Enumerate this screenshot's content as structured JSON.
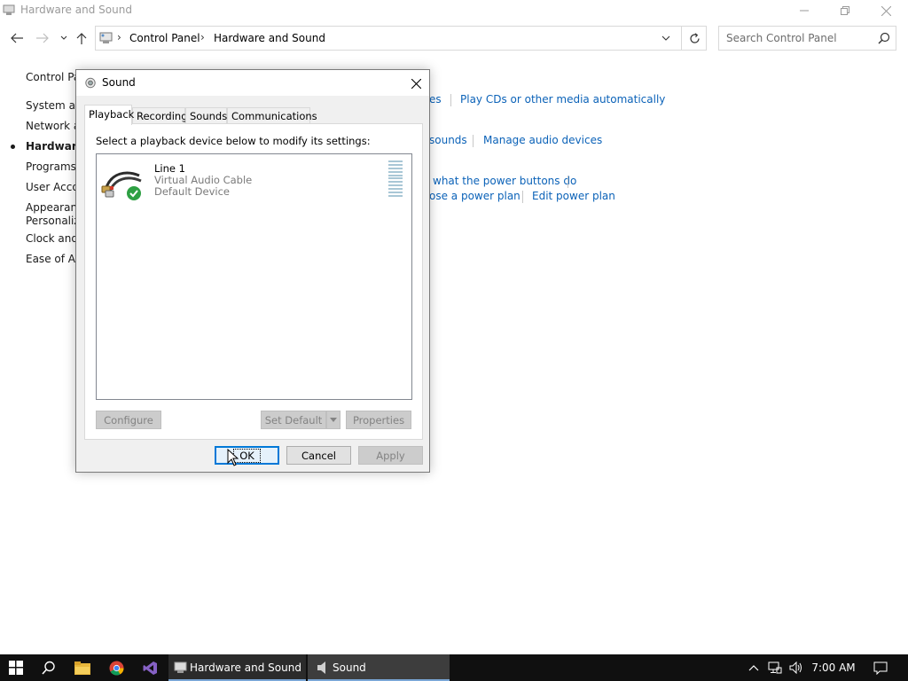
{
  "window": {
    "title": "Hardware and Sound"
  },
  "address": {
    "crumbs": [
      "Control Panel",
      "Hardware and Sound"
    ],
    "search_placeholder": "Search Control Panel"
  },
  "leftnav": {
    "items": [
      {
        "label": "Control Pa"
      },
      {
        "label": "System an"
      },
      {
        "label": "Network ar"
      },
      {
        "label": "Hardware"
      },
      {
        "label": "Programs"
      },
      {
        "label": "User Accou"
      },
      {
        "label": "Appearanc"
      },
      {
        "label": "Personaliz"
      },
      {
        "label": "Clock and"
      },
      {
        "label": "Ease of Ac"
      }
    ]
  },
  "content_links": {
    "autoplay_partial": "es",
    "autoplay_cds": "Play CDs or other media automatically",
    "sound_partial": "sounds",
    "manage_audio": "Manage audio devices",
    "power_buttons_partial": "what the power buttons do",
    "power_plan_partial": "ose a power plan",
    "edit_power_plan": "Edit power plan"
  },
  "dialog": {
    "title": "Sound",
    "tabs": [
      "Playback",
      "Recording",
      "Sounds",
      "Communications"
    ],
    "active_tab": "Playback",
    "instruction": "Select a playback device below to modify its settings:",
    "device": {
      "name": "Line 1",
      "description": "Virtual Audio Cable",
      "status": "Default Device"
    },
    "buttons": {
      "configure": "Configure",
      "set_default": "Set Default",
      "properties": "Properties",
      "ok": "OK",
      "cancel": "Cancel",
      "apply": "Apply"
    }
  },
  "taskbar": {
    "apps": [
      {
        "label": "Hardware and Sound"
      },
      {
        "label": "Sound"
      }
    ],
    "clock": "7:00 AM"
  },
  "colors": {
    "link": "#0b62b8",
    "taskbar": "#101010",
    "focus": "#0078d7"
  }
}
